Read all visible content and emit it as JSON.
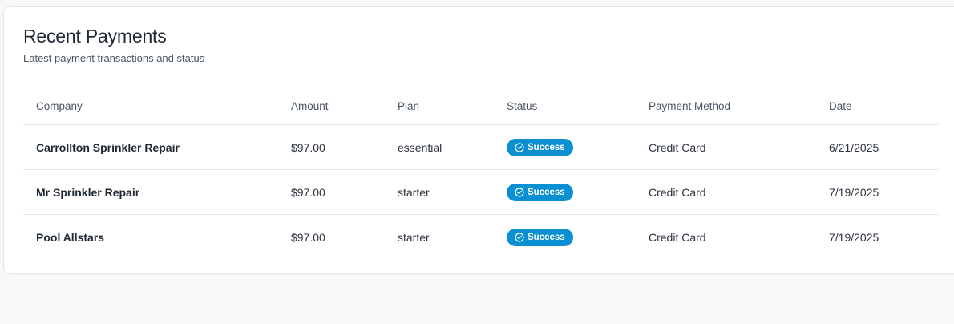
{
  "header": {
    "title": "Recent Payments",
    "subtitle": "Latest payment transactions and status"
  },
  "table": {
    "columns": {
      "company": "Company",
      "amount": "Amount",
      "plan": "Plan",
      "status": "Status",
      "method": "Payment Method",
      "date": "Date"
    },
    "rows": [
      {
        "company": "Carrollton Sprinkler Repair",
        "amount": "$97.00",
        "plan": "essential",
        "status": "Success",
        "method": "Credit Card",
        "date": "6/21/2025"
      },
      {
        "company": "Mr Sprinkler Repair",
        "amount": "$97.00",
        "plan": "starter",
        "status": "Success",
        "method": "Credit Card",
        "date": "7/19/2025"
      },
      {
        "company": "Pool Allstars",
        "amount": "$97.00",
        "plan": "starter",
        "status": "Success",
        "method": "Credit Card",
        "date": "7/19/2025"
      }
    ]
  },
  "colors": {
    "success_badge": "#0a8fd0",
    "page_background": "#f7f8fa",
    "card_background": "#ffffff"
  },
  "icons": {
    "status": "check-circle-icon"
  }
}
